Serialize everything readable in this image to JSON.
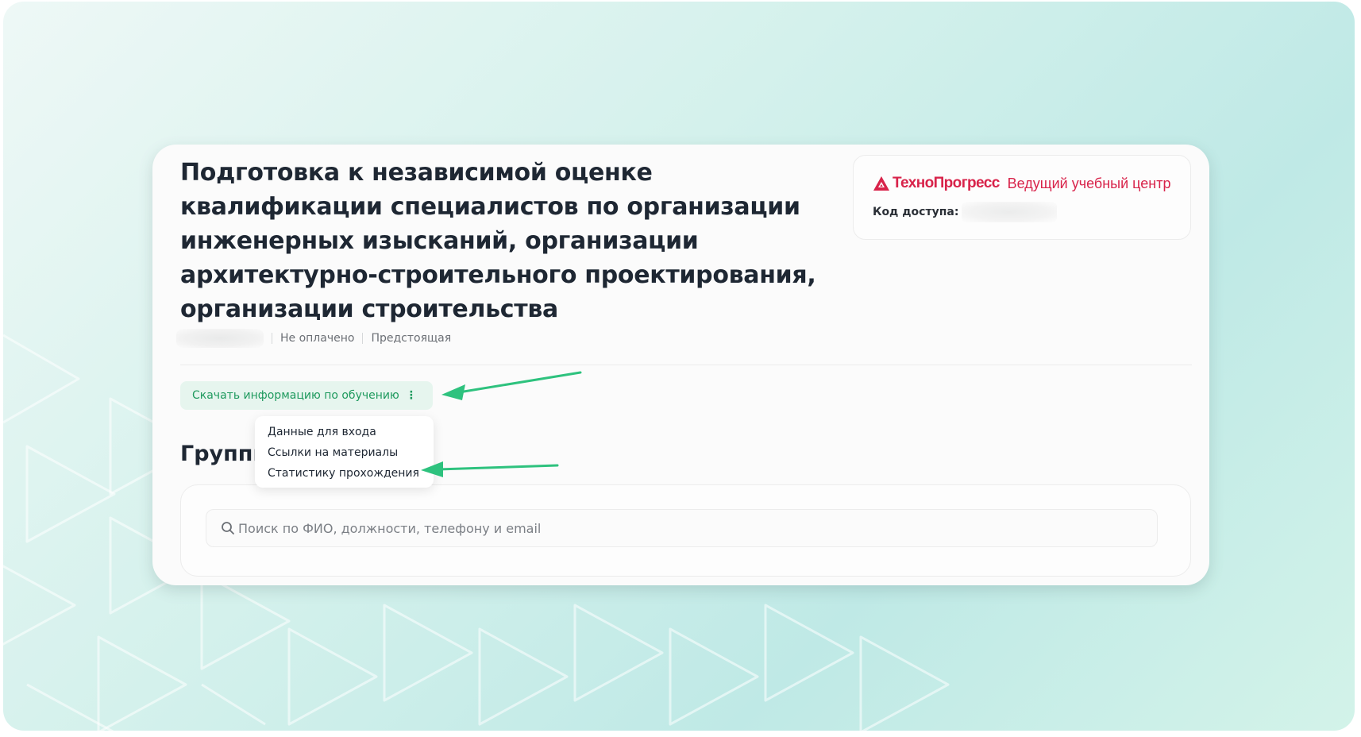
{
  "course": {
    "title": "Подготовка к независимой оценке квалификации специалистов по организации инженерных изысканий, организации архитектурно-строительного проектирования, организации строительства",
    "payment_status": "Не оплачено",
    "schedule_status": "Предстоящая"
  },
  "provider": {
    "logo_text": "ТехноПрогресс",
    "subtitle": "Ведущий учебный центр",
    "access_code_label": "Код доступа:",
    "brand_color": "#d8234a"
  },
  "download": {
    "button_label": "Скачать информацию по обучению",
    "menu_icon": "kebab-icon",
    "menu_items": [
      "Данные для входа",
      "Ссылки на материалы",
      "Статистику прохождения"
    ]
  },
  "groups": {
    "heading": "Группы"
  },
  "search": {
    "placeholder": "Поиск по ФИО, должности, телефону и email"
  },
  "colors": {
    "accent_green": "#1f9a5e",
    "annotation_arrow": "#2ec27e",
    "title_text": "#1e2733"
  }
}
